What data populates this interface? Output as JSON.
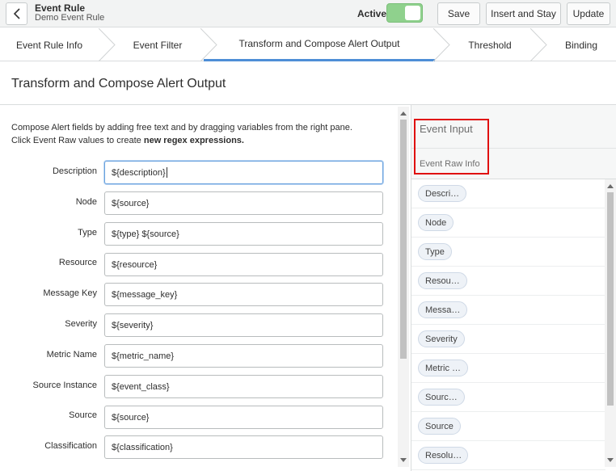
{
  "header": {
    "title": "Event Rule",
    "subtitle": "Demo Event Rule",
    "active_label": "Active",
    "active": true,
    "save_label": "Save",
    "insert_stay_label": "Insert and Stay",
    "update_label": "Update"
  },
  "tabs": [
    {
      "label": "Event Rule Info",
      "active": false
    },
    {
      "label": "Event Filter",
      "active": false
    },
    {
      "label": "Transform and Compose Alert Output",
      "active": true
    },
    {
      "label": "Threshold",
      "active": false
    },
    {
      "label": "Binding",
      "active": false
    }
  ],
  "page_title": "Transform and Compose Alert Output",
  "intro": {
    "line1": "Compose Alert fields by adding free text and by dragging variables from the right pane.",
    "line2_prefix": "Click Event Raw values to create ",
    "line2_link": "new regex expressions."
  },
  "fields": [
    {
      "label": "Description",
      "value": "${description}"
    },
    {
      "label": "Node",
      "value": "${source}"
    },
    {
      "label": "Type",
      "value": "${type} ${source}"
    },
    {
      "label": "Resource",
      "value": "${resource}"
    },
    {
      "label": "Message Key",
      "value": "${message_key}"
    },
    {
      "label": "Severity",
      "value": "${severity}"
    },
    {
      "label": "Metric Name",
      "value": "${metric_name}"
    },
    {
      "label": "Source Instance",
      "value": "${event_class}"
    },
    {
      "label": "Source",
      "value": "${source}"
    },
    {
      "label": "Classification",
      "value": "${classification}"
    }
  ],
  "right_pane": {
    "title": "Event Input",
    "subtitle": "Event Raw Info",
    "variables": [
      "Descri…",
      "Node",
      "Type",
      "Resou…",
      "Messa…",
      "Severity",
      "Metric …",
      "Sourc…",
      "Source",
      "Resolu…"
    ]
  },
  "colors": {
    "accent": "#4e8ed6",
    "toggle_on": "#8fd18d",
    "highlight_box": "#e01010"
  }
}
